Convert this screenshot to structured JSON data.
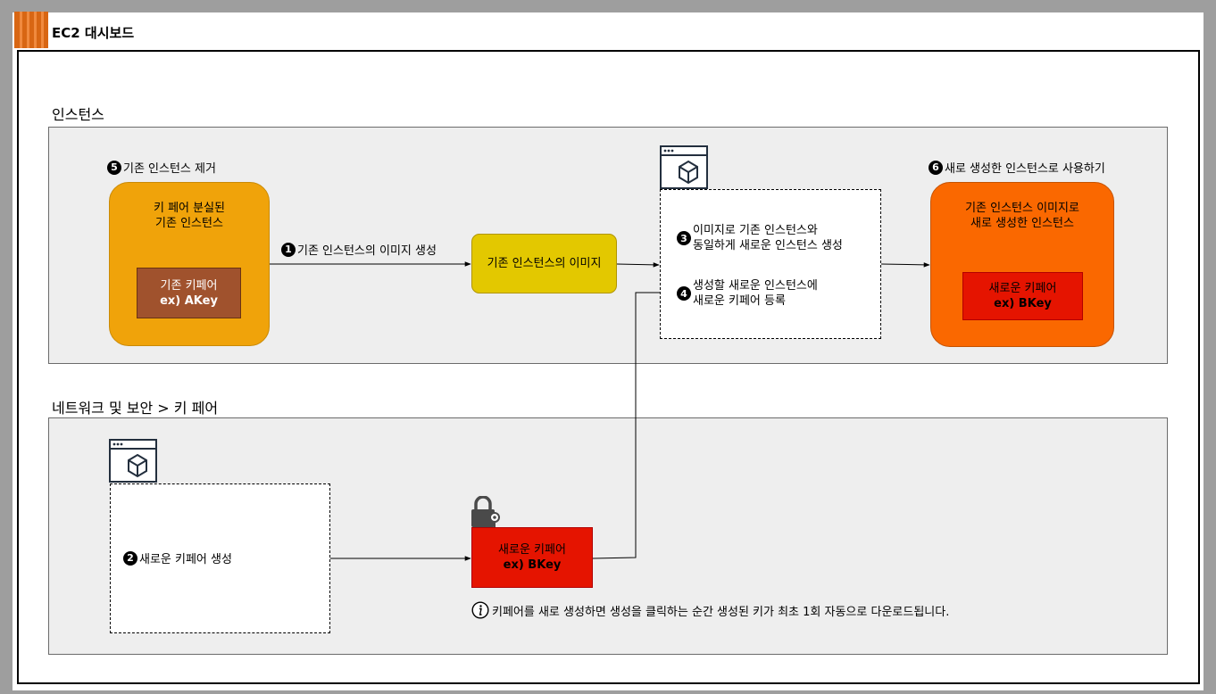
{
  "header": {
    "title": "EC2 대시보드"
  },
  "sections": {
    "instances": "인스턴스",
    "network": "네트워크 및 보안 > 키 페어"
  },
  "nodes": {
    "old_instance": {
      "line1": "키 페어 분실된",
      "line2": "기존 인스턴스"
    },
    "old_keypair": {
      "line1": "기존 키페어",
      "line2": "ex) AKey"
    },
    "image": {
      "label": "기존 인스턴스의 이미지"
    },
    "new_instance": {
      "line1": "기존 인스턴스 이미지로",
      "line2": "새로 생성한 인스턴스"
    },
    "new_keypair_in_instance": {
      "line1": "새로운 키페어",
      "line2": "ex) BKey"
    },
    "new_keypair": {
      "line1": "새로운 키페어",
      "line2": "ex) BKey"
    }
  },
  "steps": {
    "s1": {
      "num": "1",
      "text": "기존 인스턴스의 이미지 생성"
    },
    "s2": {
      "num": "2",
      "text": "새로운 키페어 생성"
    },
    "s3": {
      "num": "3",
      "line1": "이미지로 기존 인스턴스와",
      "line2": "동일하게 새로운 인스턴스 생성"
    },
    "s4": {
      "num": "4",
      "line1": "생성할 새로운 인스턴스에",
      "line2": "새로운 키페어 등록"
    },
    "s5": {
      "num": "5",
      "text": "기존 인스턴스 제거"
    },
    "s6": {
      "num": "6",
      "text": "새로 생성한 인스턴스로 사용하기"
    }
  },
  "info": {
    "icon": "info-icon",
    "text": "키페어를 새로 생성하면 생성을 클릭하는 순간 생성된 키가 최초 1회 자동으로 다운로드됩니다."
  },
  "colors": {
    "old_instance": "#f0a30a",
    "old_keypair": "#a0522d",
    "image": "#e3c800",
    "new_instance": "#fa6800",
    "keypair_red": "#e51400"
  }
}
